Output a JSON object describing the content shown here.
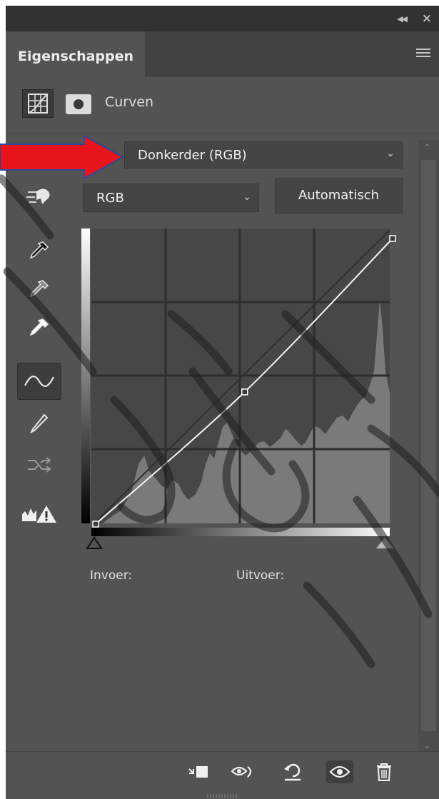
{
  "panel": {
    "tab_label": "Eigenschappen",
    "adjustment_title": "Curven"
  },
  "preset": {
    "label_partial": "",
    "value": "Donkerder (RGB)"
  },
  "channel": {
    "value": "RGB"
  },
  "auto_button": "Automatisch",
  "curve": {
    "points": [
      [
        0,
        0
      ],
      [
        128,
        118
      ],
      [
        255,
        255
      ]
    ]
  },
  "readout": {
    "input_label": "Invoer:",
    "output_label": "Uitvoer:"
  },
  "colors": {
    "panel_bg": "#535353",
    "annotation_arrow": "#e8141c"
  },
  "icons": {
    "tools": [
      "on-image-adjust-icon",
      "black-point-eyedropper-icon",
      "gray-point-eyedropper-icon",
      "white-point-eyedropper-icon",
      "curve-points-icon",
      "pencil-icon",
      "smooth-icon",
      "clipping-warning-icon"
    ],
    "bottom": [
      "clip-to-layer-icon",
      "view-previous-icon",
      "reset-icon",
      "visibility-eye-icon",
      "trash-icon"
    ]
  }
}
